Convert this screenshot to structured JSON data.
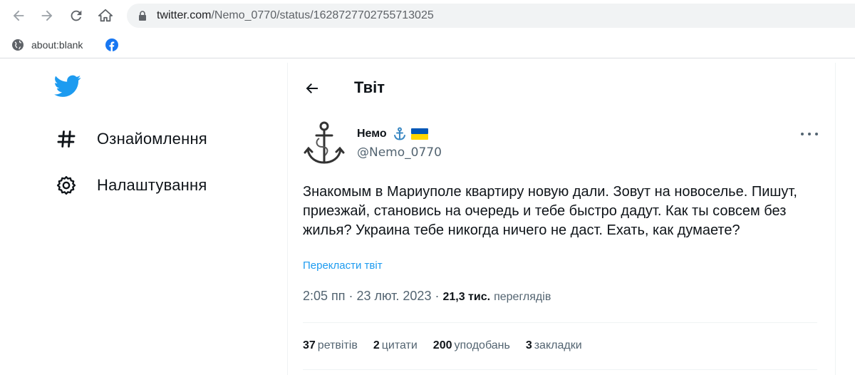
{
  "browser": {
    "url_host": "twitter.com",
    "url_path": "/Nemo_0770/status/1628727702755713025",
    "bookmarks": [
      {
        "label": "about:blank",
        "icon": "globe-icon"
      },
      {
        "label": "",
        "icon": "facebook-icon"
      }
    ]
  },
  "sidebar": {
    "logo": "twitter-bird-icon",
    "items": [
      {
        "label": "Ознайомлення",
        "icon": "hashtag-icon"
      },
      {
        "label": "Налаштування",
        "icon": "gear-icon"
      }
    ]
  },
  "header": {
    "title": "Твіт"
  },
  "tweet": {
    "author_name": "Немо",
    "author_emoji": "⚓",
    "author_handle": "@Nemo_0770",
    "text": "Знакомым в Мариуполе квартиру новую дали. Зовут на новоселье. Пишут, приезжай, становись на очередь и тебе быстро дадут. Как ты совсем без жилья? Украина тебе никогда ничего не даст. Ехать, как думаете?",
    "translate_label": "Перекласти твіт",
    "time": "2:05 пп",
    "date": "23 лют. 2023",
    "views_count": "21,3 тис.",
    "views_label": "переглядів",
    "stats": [
      {
        "num": "37",
        "label": "ретвітів"
      },
      {
        "num": "2",
        "label": "цитати"
      },
      {
        "num": "200",
        "label": "уподобань"
      },
      {
        "num": "3",
        "label": "закладки"
      }
    ]
  },
  "colors": {
    "twitter_blue": "#1d9bf0",
    "secondary_text": "#536471",
    "primary_text": "#0f1419",
    "flag_blue": "#0057b7",
    "flag_yellow": "#ffd700"
  }
}
